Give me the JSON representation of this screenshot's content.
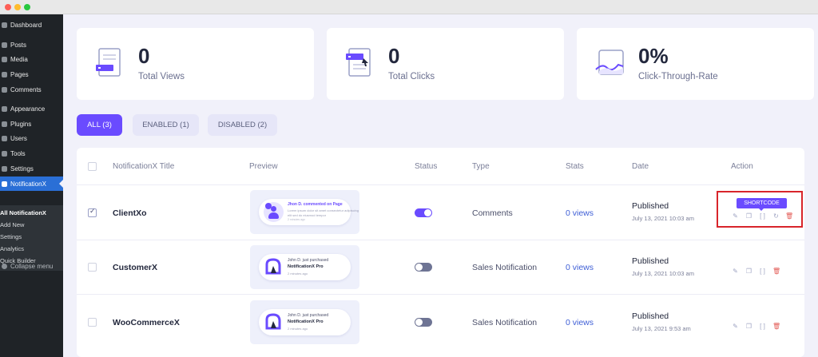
{
  "sidebar": {
    "items": [
      {
        "label": "Dashboard"
      },
      {
        "label": "Posts"
      },
      {
        "label": "Media"
      },
      {
        "label": "Pages"
      },
      {
        "label": "Comments"
      },
      {
        "label": "Appearance"
      },
      {
        "label": "Plugins"
      },
      {
        "label": "Users"
      },
      {
        "label": "Tools"
      },
      {
        "label": "Settings"
      },
      {
        "label": "NotificationX"
      }
    ],
    "submenu": [
      {
        "label": "All NotificationX"
      },
      {
        "label": "Add New"
      },
      {
        "label": "Settings"
      },
      {
        "label": "Analytics"
      },
      {
        "label": "Quick Builder"
      }
    ],
    "collapse": "Collapse menu"
  },
  "stats": [
    {
      "value": "0",
      "label": "Total Views",
      "icon": "views-document-icon"
    },
    {
      "value": "0",
      "label": "Total Clicks",
      "icon": "clicks-document-icon"
    },
    {
      "value": "0%",
      "label": "Click-Through-Rate",
      "icon": "ctr-chart-icon"
    }
  ],
  "tabs": [
    {
      "label": "ALL (3)"
    },
    {
      "label": "ENABLED (1)"
    },
    {
      "label": "DISABLED (2)"
    }
  ],
  "table": {
    "headers": {
      "title": "NotificationX Title",
      "preview": "Preview",
      "status": "Status",
      "type": "Type",
      "stats": "Stats",
      "date": "Date",
      "action": "Action"
    },
    "shortcode_label": "SHORTCODE",
    "rows": [
      {
        "title": "ClientXo",
        "checked": true,
        "enabled": true,
        "type": "Comments",
        "stats": "0 views",
        "status": "Published",
        "date": "July 13, 2021 10:03 am",
        "preview": {
          "line1": "Jhon D. commented on Page",
          "line2": "Lorem ipsum dolor sit amet consectetur adipiscing",
          "line3": "elit sed do eiusmod tempor",
          "line4": "2 minutes ago"
        }
      },
      {
        "title": "CustomerX",
        "checked": false,
        "enabled": false,
        "type": "Sales Notification",
        "stats": "0 views",
        "status": "Published",
        "date": "July 13, 2021 10:03 am",
        "preview": {
          "line1": "John D. just purchased",
          "line2": "NotificationX Pro",
          "line3": "2 minutes ago"
        }
      },
      {
        "title": "WooCommerceX",
        "checked": false,
        "enabled": false,
        "type": "Sales Notification",
        "stats": "0 views",
        "status": "Published",
        "date": "July 13, 2021 9:53 am",
        "preview": {
          "line1": "John D. just purchased",
          "line2": "NotificationX Pro",
          "line3": "2 minutes ago"
        }
      }
    ]
  },
  "colors": {
    "accent": "#6a4bff",
    "sidebar_bg": "#1f2327",
    "sidebar_active": "#2a6fd6",
    "highlight_box": "#d8252b",
    "delete": "#e35d58",
    "link": "#3f5fd6"
  }
}
